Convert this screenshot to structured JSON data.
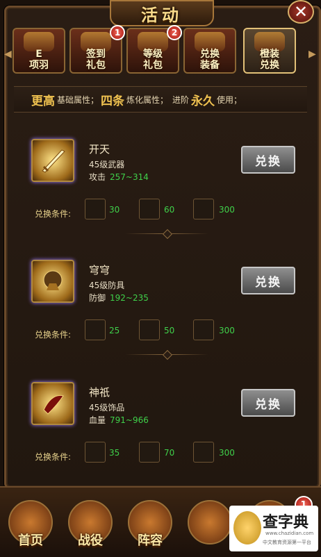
{
  "window": {
    "title": "活动",
    "close_label": "✕"
  },
  "tabs": [
    {
      "label": "E\n项羽",
      "badge": ""
    },
    {
      "label": "签到\n礼包",
      "badge": "1"
    },
    {
      "label": "等级\n礼包",
      "badge": "2"
    },
    {
      "label": "兑换\n装备",
      "badge": ""
    },
    {
      "label": "橙装\n兑换",
      "badge": ""
    }
  ],
  "info_bar": {
    "p1": "更高",
    "t1": "基础属性；",
    "p2": "四条",
    "t2": "炼化属性；",
    "t3": "进阶",
    "p3": "永久",
    "t4": "使用；"
  },
  "items": [
    {
      "name": "开天",
      "type": "45级武器",
      "stat_label": "攻击",
      "stat_value": "257~314",
      "cond_label": "兑换条件:",
      "costs": [
        "30",
        "60",
        "300"
      ],
      "button": "兑换"
    },
    {
      "name": "穹穹",
      "type": "45级防具",
      "stat_label": "防御",
      "stat_value": "192~235",
      "cond_label": "兑换条件:",
      "costs": [
        "25",
        "50",
        "300"
      ],
      "button": "兑换"
    },
    {
      "name": "神祇",
      "type": "45级饰品",
      "stat_label": "血量",
      "stat_value": "791~966",
      "cond_label": "兑换条件:",
      "costs": [
        "35",
        "70",
        "300"
      ],
      "button": "兑换"
    }
  ],
  "bottom_nav": [
    {
      "label": "首页"
    },
    {
      "label": "战役"
    },
    {
      "label": "阵容"
    },
    {
      "label": ""
    },
    {
      "label": ""
    }
  ],
  "bottom_nav_badge": "1",
  "watermark": {
    "title": "查字典",
    "url": "www.chazidian.com",
    "tagline": "中文教育资源第一平台"
  }
}
